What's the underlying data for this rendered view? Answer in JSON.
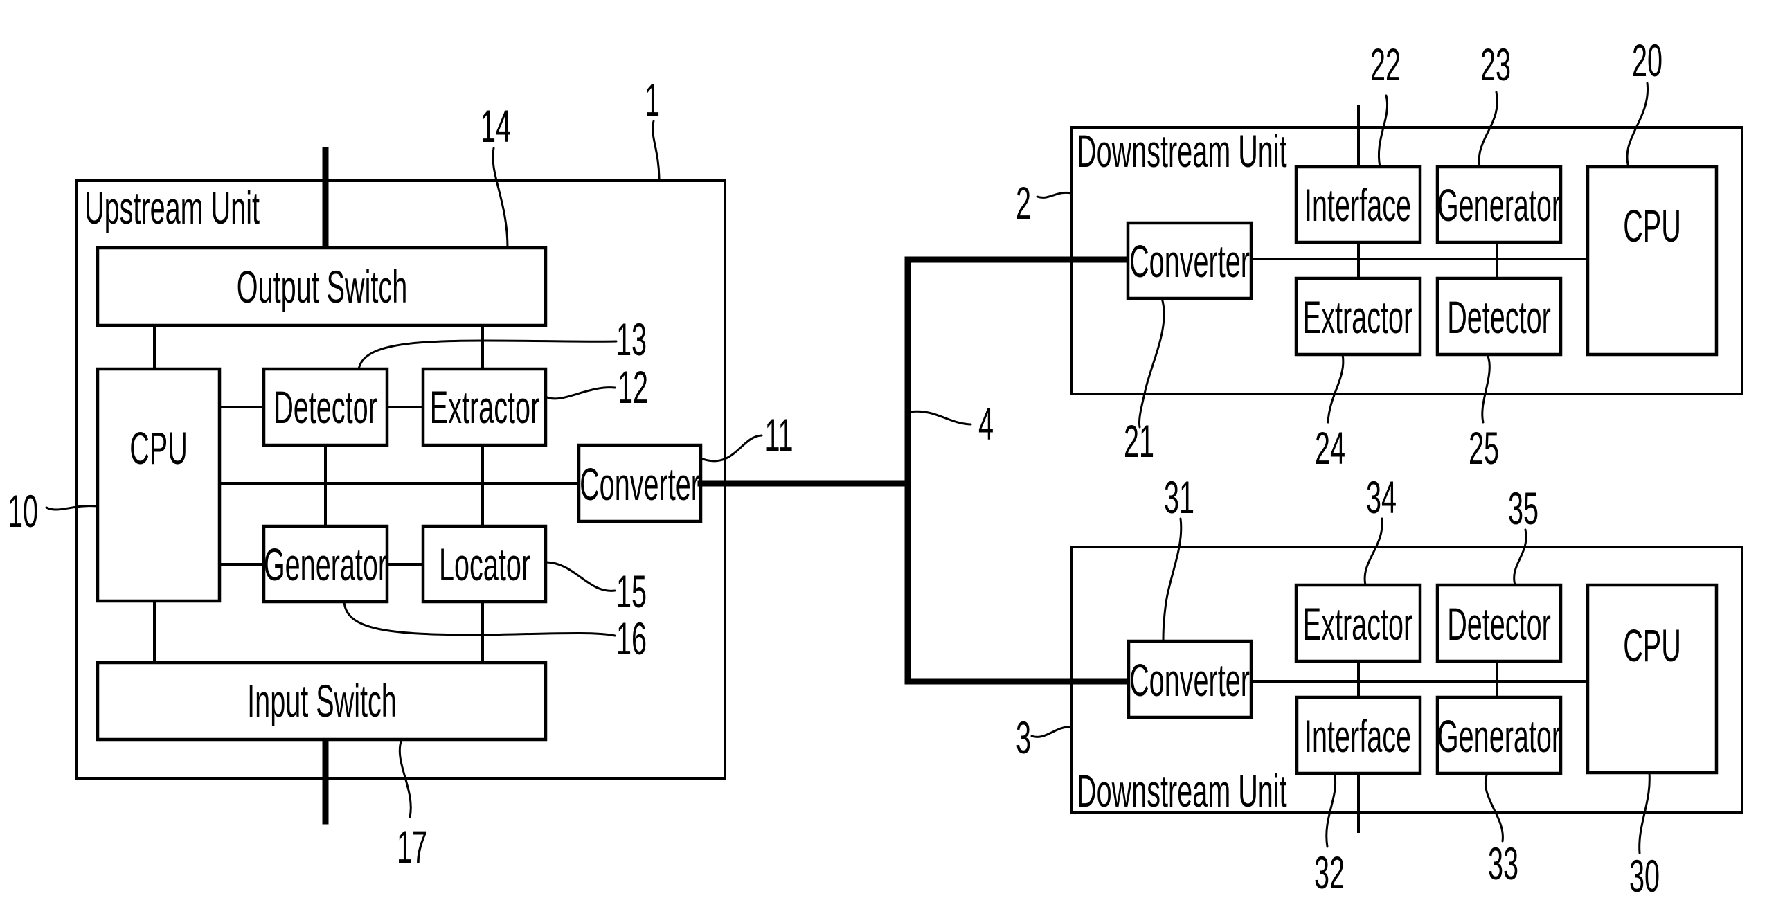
{
  "figure": {
    "upstream_unit": {
      "ref": "1",
      "title": "Upstream Unit",
      "blocks": {
        "output_switch": {
          "label": "Output Switch",
          "ref": "14"
        },
        "cpu": {
          "label": "CPU",
          "ref": "10"
        },
        "detector": {
          "label": "Detector",
          "ref": "13"
        },
        "extractor": {
          "label": "Extractor",
          "ref": "12"
        },
        "converter": {
          "label": "Converter",
          "ref": "11"
        },
        "generator": {
          "label": "Generator",
          "ref": "16"
        },
        "locator": {
          "label": "Locator",
          "ref": "15"
        },
        "input_switch": {
          "label": "Input Switch",
          "ref": "17"
        }
      }
    },
    "bus": {
      "ref": "4"
    },
    "downstream_unit_a": {
      "ref": "2",
      "title": "Downstream Unit",
      "blocks": {
        "converter": {
          "label": "Converter",
          "ref": "21"
        },
        "interface": {
          "label": "Interface",
          "ref": "22"
        },
        "generator": {
          "label": "Generator",
          "ref": "23"
        },
        "extractor": {
          "label": "Extractor",
          "ref": "24"
        },
        "detector": {
          "label": "Detector",
          "ref": "25"
        },
        "cpu": {
          "label": "CPU",
          "ref": "20"
        }
      }
    },
    "downstream_unit_b": {
      "ref": "3",
      "title": "Downstream Unit",
      "blocks": {
        "converter": {
          "label": "Converter",
          "ref": "31"
        },
        "extractor": {
          "label": "Extractor",
          "ref": "34"
        },
        "detector": {
          "label": "Detector",
          "ref": "35"
        },
        "interface": {
          "label": "Interface",
          "ref": "32"
        },
        "generator": {
          "label": "Generator",
          "ref": "33"
        },
        "cpu": {
          "label": "CPU",
          "ref": "30"
        }
      }
    }
  }
}
